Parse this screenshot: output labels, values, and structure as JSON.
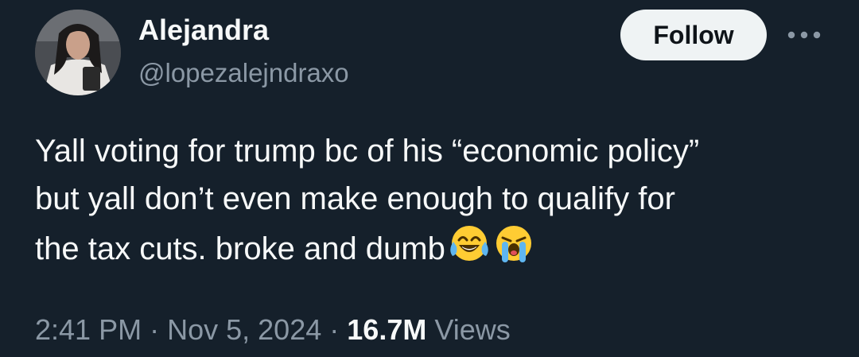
{
  "author": {
    "display_name": "Alejandra",
    "handle": "@lopezalejndraxo",
    "avatar_icon": "profile-photo"
  },
  "actions": {
    "follow_label": "Follow",
    "more_icon": "more-horizontal-icon"
  },
  "tweet": {
    "line1": "Yall voting for trump bc of his “economic policy”",
    "line2": "but yall don’t even make enough to qualify for",
    "line3": "the tax cuts. broke and dumb",
    "emojis": [
      "face-with-tears-of-joy",
      "loudly-crying-face"
    ]
  },
  "meta": {
    "time": "2:41 PM",
    "separator": "·",
    "date": "Nov 5, 2024",
    "views_count": "16.7M",
    "views_label": "Views"
  },
  "colors": {
    "background": "#15202b",
    "text_primary": "#f7f9f9",
    "text_secondary": "#8b98a5",
    "follow_bg": "#eff3f4",
    "follow_text": "#0f1419"
  }
}
